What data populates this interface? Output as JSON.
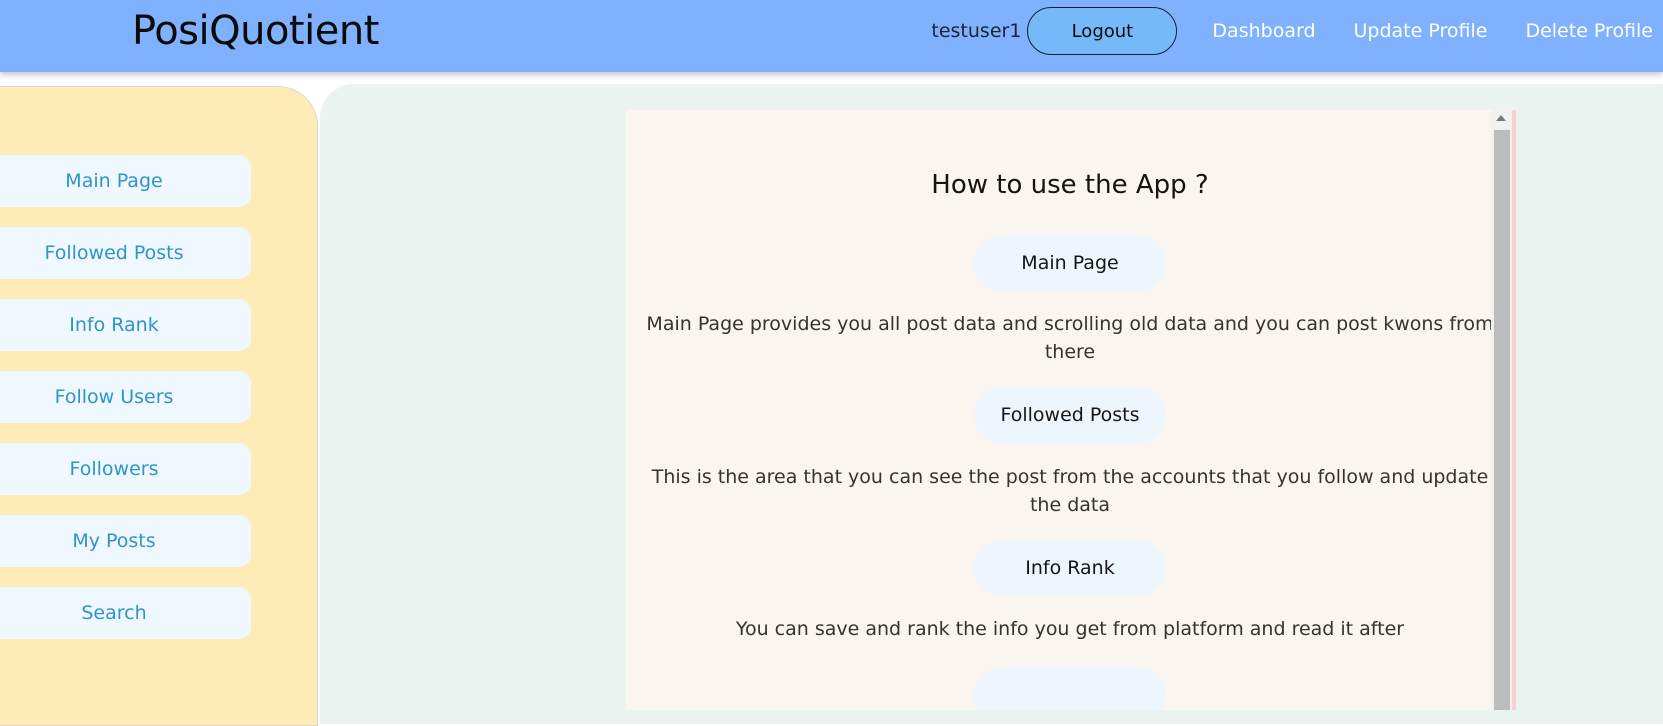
{
  "header": {
    "brand": "PosiQuotient",
    "username": "testuser1",
    "logout_label": "Logout",
    "links": [
      "Dashboard",
      "Update Profile",
      "Delete Profile"
    ]
  },
  "sidebar": {
    "items": [
      {
        "label": "Main Page"
      },
      {
        "label": "Followed Posts"
      },
      {
        "label": "Info Rank"
      },
      {
        "label": "Follow Users"
      },
      {
        "label": "Followers"
      },
      {
        "label": "My Posts"
      },
      {
        "label": "Search"
      }
    ]
  },
  "help": {
    "title": "How to use the App ?",
    "sections": [
      {
        "heading": "Main Page",
        "text": "Main Page provides you all post data and scrolling old data and you can post kwons from there"
      },
      {
        "heading": "Followed Posts",
        "text": "This is the area that you can see the post from the accounts that you follow and update the data"
      },
      {
        "heading": "Info Rank",
        "text": "You can save and rank the info you get from platform and read it after"
      }
    ]
  },
  "colors": {
    "header_bg": "#7fb1ff",
    "logout_bg": "#76b9f8",
    "sidebar_bg": "#ffebb5",
    "sidebar_item_bg": "#eff7ff",
    "sidebar_text": "#2e95c9",
    "main_bg": "#ebf3f1",
    "card_bg": "#faf5ef"
  }
}
